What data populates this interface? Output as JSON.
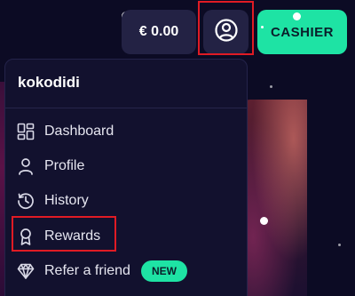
{
  "header": {
    "balance": "€ 0.00",
    "cashier_label": "CASHIER"
  },
  "menu": {
    "username": "kokodidi",
    "items": [
      {
        "label": "Dashboard",
        "icon": "dashboard-icon"
      },
      {
        "label": "Profile",
        "icon": "user-icon"
      },
      {
        "label": "History",
        "icon": "history-icon"
      },
      {
        "label": "Rewards",
        "icon": "award-icon"
      },
      {
        "label": "Refer a friend",
        "icon": "diamond-icon",
        "badge": "NEW"
      }
    ]
  },
  "colors": {
    "accent": "#1ee3a4",
    "background": "#0c0b24",
    "panel": "#12112e",
    "button": "#232244",
    "highlight": "#e01b24"
  }
}
